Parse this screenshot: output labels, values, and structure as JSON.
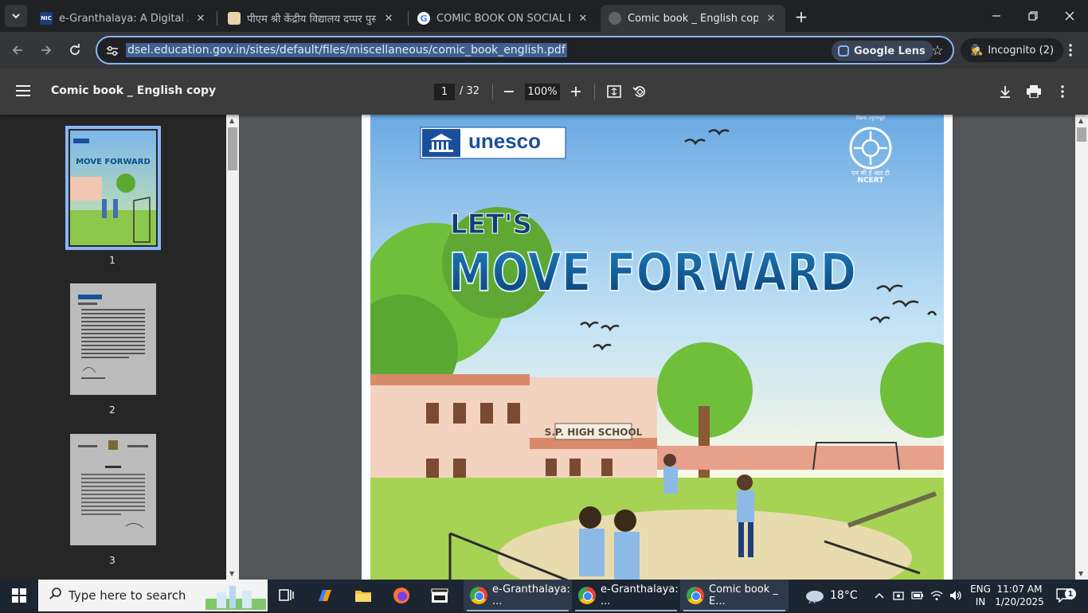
{
  "browser": {
    "tabs": [
      {
        "title": "e-Granthalaya: A Digital Agenda",
        "favicon": "NIC"
      },
      {
        "title": "पीएम श्री केंद्रीय विद्यालय दप्पर पुस्तकालय",
        "favicon": ""
      },
      {
        "title": "COMIC BOOK ON SOCIAL HEALTH",
        "favicon": "G"
      },
      {
        "title": "Comic book _ English copy",
        "favicon": ""
      }
    ],
    "tab_close": "✕",
    "new_tab": "+",
    "address": {
      "url": "dsel.education.gov.in/sites/default/files/miscellaneous/comic_book_english.pdf",
      "lens_label": "Google Lens"
    },
    "incognito_label": "Incognito (2)"
  },
  "pdf": {
    "title": "Comic book _ English copy",
    "current_page": "1",
    "total_pages": "/ 32",
    "zoom": "100%",
    "thumbnails": [
      "1",
      "2",
      "3"
    ]
  },
  "cover": {
    "publisher_left": "unesco",
    "publisher_right": "NCERT",
    "emblem_caption_top": "विद्यया ऽमृतमश्नुते",
    "emblem_caption_hindi": "एन सी ई आर टी",
    "title_small": "LET'S",
    "title_big": "MOVE FORWARD",
    "school_sign": "S.P. HIGH SCHOOL"
  },
  "taskbar": {
    "search_placeholder": "Type here to search",
    "apps": [
      {
        "label": "e-Granthalaya: ..."
      },
      {
        "label": "e-Granthalaya: ..."
      },
      {
        "label": "Comic book _ E..."
      }
    ],
    "weather": "18°C",
    "lang_top": "ENG",
    "lang_bottom": "IN",
    "time": "11:07 AM",
    "date": "1/20/2025",
    "notification_count": "1"
  }
}
